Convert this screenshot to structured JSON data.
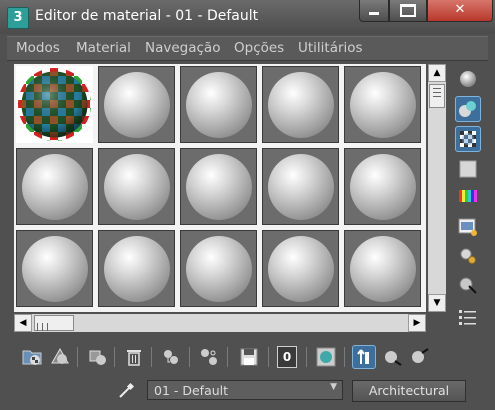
{
  "window": {
    "title": "Editor de material - 01 - Default",
    "app_icon_glyph": "3",
    "controls": {
      "minimize_icon": "minimize-icon",
      "maximize_icon": "maximize-icon",
      "close_icon": "close-icon",
      "close_glyph": "✕"
    }
  },
  "menu": [
    "Modos",
    "Material",
    "Navegação",
    "Opções",
    "Utilitários"
  ],
  "slots": {
    "rows": 3,
    "cols": 5,
    "selected_index": 0,
    "selected_pattern": "checker-map",
    "default_pattern": "gray-sphere"
  },
  "scrollbars": {
    "up_arrow": "▲",
    "down_arrow": "▼",
    "left_arrow": "◀",
    "right_arrow": "▶"
  },
  "side_tools": [
    "sample-type-sphere-icon",
    "backlight-icon",
    "background-checker-icon",
    "sample-uv-tiling-icon",
    "video-color-check-icon",
    "make-preview-icon",
    "options-icon",
    "select-by-material-icon",
    "material-navigator-icon"
  ],
  "bottom_tools": [
    "get-material-icon",
    "put-to-scene-icon",
    "assign-to-selection-icon",
    "reset-map-icon",
    "copy-material-icon",
    "make-unique-icon",
    "put-to-library-icon",
    "material-id-channel-icon",
    "show-shaded-material-icon",
    "show-end-result-icon",
    "go-to-parent-icon",
    "go-forward-to-sibling-icon"
  ],
  "material_id_channel": "0",
  "material_name": "01 - Default",
  "material_type": "Architectural",
  "colors": {
    "accent": "#3d6f9c",
    "close": "#c4473a",
    "panel": "#505050"
  }
}
